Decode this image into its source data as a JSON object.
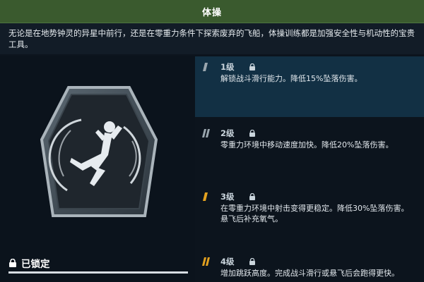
{
  "header": {
    "title": "体操"
  },
  "description": "无论是在地势钟灵的异星中前行，还是在零重力条件下探索废弃的飞船，体操训练都是加强安全性与机动性的宝贵工具。",
  "left": {
    "badge_icon": "gymnast-flip-icon",
    "status_label": "已锁定",
    "status_icon": "lock-icon"
  },
  "levels": [
    {
      "name": "1级",
      "desc": "解锁战斗滑行能力。降低15%坠落伤害。",
      "color": "#9aa6ae",
      "active": true
    },
    {
      "name": "2级",
      "desc": "零重力环境中移动速度加快。降低20%坠落伤害。",
      "color": "#9aa6ae",
      "active": false
    },
    {
      "name": "3级",
      "desc": "在零重力环境中射击变得更稳定。降低30%坠落伤害。\n悬飞后补充氧气。",
      "color": "#e3a11f",
      "active": false
    },
    {
      "name": "4级",
      "desc": "增加跳跃高度。完成战斗滑行或悬飞后会跑得更快。",
      "color": "#e3a11f",
      "active": false
    }
  ],
  "colors": {
    "header_bg": "#3a5a2e",
    "active_row": "#123044",
    "rank_gold": "#e3a11f",
    "rank_grey": "#9aa6ae"
  }
}
